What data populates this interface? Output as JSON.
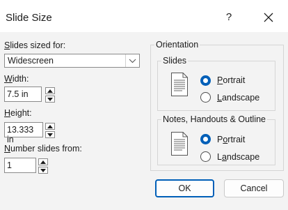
{
  "window": {
    "title": "Slide Size",
    "help_label": "?"
  },
  "slides_sized_for": {
    "label_u": "S",
    "label_rest": "lides sized for:",
    "value": "Widescreen"
  },
  "width": {
    "label_u": "W",
    "label_rest": "idth:",
    "value": "7.5 in"
  },
  "height": {
    "label_u": "H",
    "label_rest": "eight:",
    "value": "13.333 in"
  },
  "number_from": {
    "label_u": "N",
    "label_rest": "umber slides from:",
    "value": "1"
  },
  "orientation": {
    "label": "Orientation",
    "slides": {
      "label": "Slides",
      "portrait_u": "P",
      "portrait_rest": "ortrait",
      "landscape_u": "L",
      "landscape_rest": "andscape",
      "selected": "Portrait"
    },
    "notes": {
      "label": "Notes, Handouts & Outline",
      "portrait_u": "o",
      "portrait_pre": "P",
      "portrait_rest": "rtrait",
      "landscape_u": "a",
      "landscape_pre": "L",
      "landscape_rest": "ndscape",
      "selected": "Portrait"
    }
  },
  "buttons": {
    "ok": "OK",
    "cancel": "Cancel"
  },
  "colors": {
    "accent": "#005fb8",
    "background": "#f3f3f3"
  }
}
